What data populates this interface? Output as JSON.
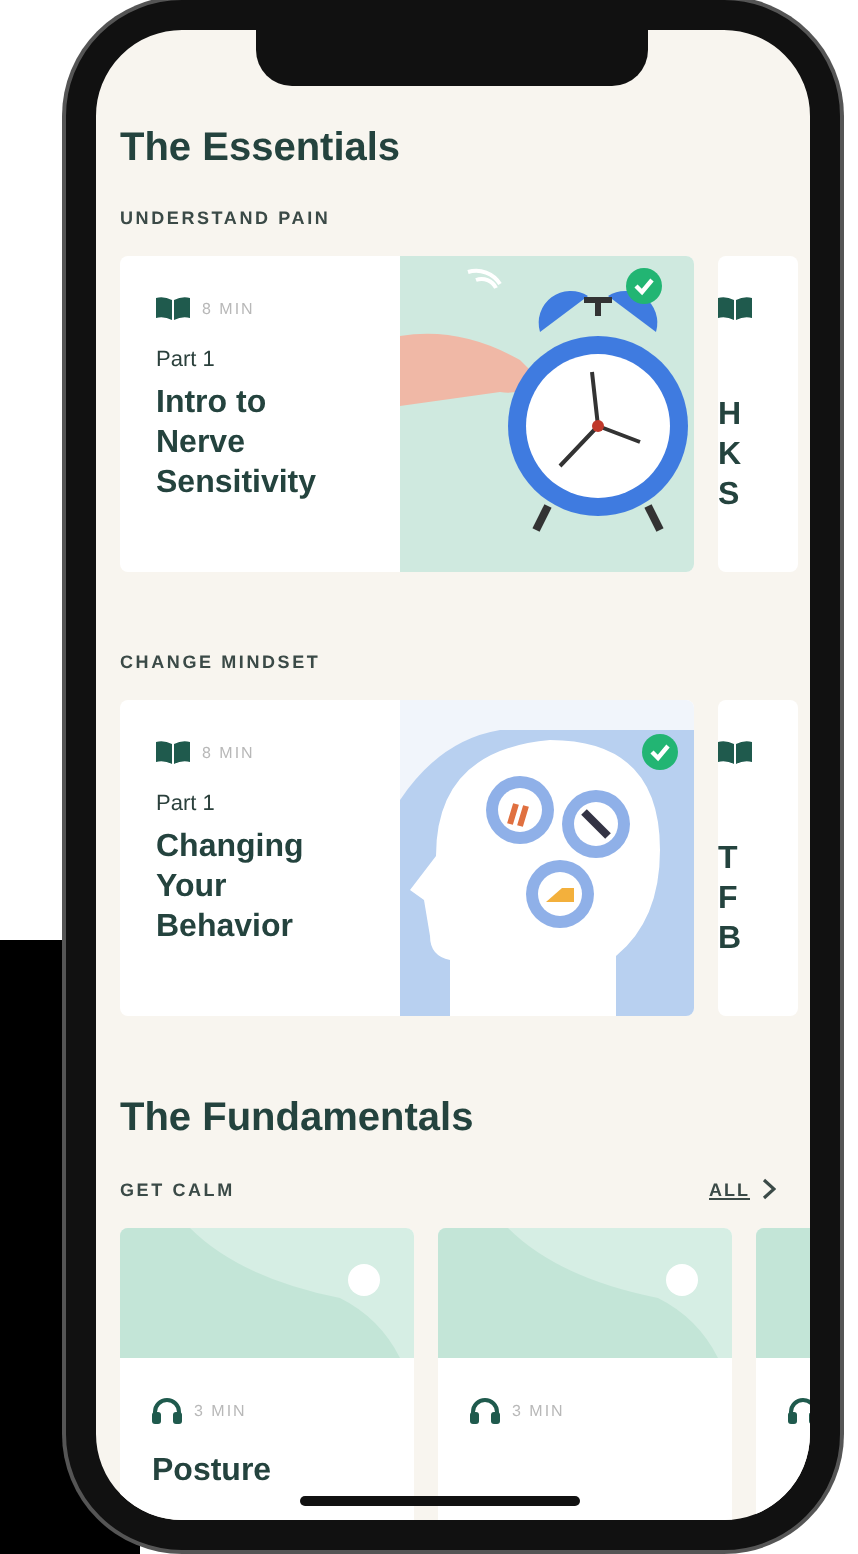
{
  "sections": [
    {
      "title": "The Essentials",
      "groups": [
        {
          "label": "UNDERSTAND PAIN",
          "cards": [
            {
              "kind": "lesson-clock",
              "duration": "8 MIN",
              "part": "Part 1",
              "title": "Intro to Nerve Sensitivity",
              "completed": true
            },
            {
              "kind": "peek",
              "title_lines": [
                "H",
                "K",
                "S"
              ]
            }
          ]
        },
        {
          "label": "CHANGE MINDSET",
          "cards": [
            {
              "kind": "lesson-head",
              "duration": "8 MIN",
              "part": "Part 1",
              "title": "Changing Your Behavior",
              "completed": true
            },
            {
              "kind": "peek",
              "title_lines": [
                "T",
                "F",
                "B"
              ]
            }
          ]
        }
      ]
    },
    {
      "title": "The Fundamentals",
      "groups": [
        {
          "label": "GET CALM",
          "action": "ALL",
          "cards": [
            {
              "kind": "audio",
              "duration": "3 MIN",
              "title": "Posture"
            },
            {
              "kind": "audio",
              "duration": "3 MIN"
            },
            {
              "kind": "audio-peek"
            }
          ]
        }
      ]
    }
  ]
}
